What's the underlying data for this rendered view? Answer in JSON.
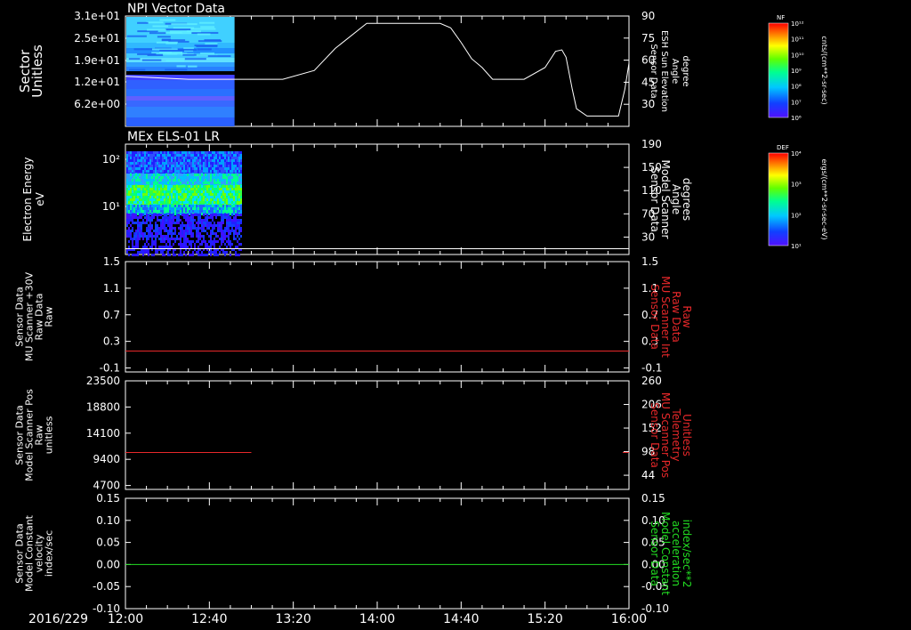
{
  "colors": {
    "background": "#000000",
    "axis": "#ffffff",
    "red_trace": "#e8282a",
    "green_trace": "#22dd22"
  },
  "time_axis": {
    "date_label": "2016/229",
    "tick_labels": [
      "12:00",
      "12:40",
      "13:20",
      "14:00",
      "14:40",
      "15:20",
      "16:00"
    ],
    "range_minutes": [
      0,
      240
    ]
  },
  "chart_data": [
    {
      "type": "heatmap",
      "title": "NPI Vector Data",
      "ylabel": [
        "Sector",
        "Unitless"
      ],
      "y_ticks": [
        "3.1e+01",
        "2.5e+01",
        "1.9e+01",
        "1.2e+01",
        "6.2e+00"
      ],
      "x_extent_minutes": [
        0,
        52
      ],
      "right_axis": {
        "label": [
          "Sensor Data",
          "ESH Sun Elevation",
          "Angle",
          "degree"
        ],
        "ticks": [
          90,
          75,
          60,
          45,
          30
        ],
        "ylim": [
          15,
          90
        ]
      },
      "line": {
        "name": "ESH Sun Elevation Angle",
        "x": [
          0,
          30,
          50,
          75,
          90,
          100,
          115,
          125,
          135,
          145,
          150,
          155,
          160,
          165,
          170,
          175,
          180,
          190,
          200,
          205,
          208,
          210,
          213,
          215,
          220,
          225,
          230,
          235,
          238,
          240
        ],
        "y": [
          49,
          47,
          47,
          47,
          53,
          68,
          85,
          85,
          85,
          85,
          85,
          82,
          72,
          61,
          55,
          47,
          47,
          47,
          55,
          66,
          67,
          62,
          40,
          27,
          22,
          22,
          22,
          22,
          40,
          58
        ]
      },
      "colorbar": {
        "label": "NF",
        "unit": "cnts/(cm**2-sr-sec)",
        "ticks": [
          "10¹²",
          "10¹¹",
          "10¹⁰",
          "10⁹",
          "10⁸",
          "10⁷",
          "10⁶"
        ]
      }
    },
    {
      "type": "heatmap",
      "title": "MEx ELS-01 LR",
      "ylabel": [
        "Electron Energy",
        "eV"
      ],
      "y_ticks": [
        "10²",
        "10¹"
      ],
      "x_extent_minutes": [
        0,
        55
      ],
      "right_axis": {
        "label": [
          "Sensor Data",
          "Model Scanner",
          "Angle",
          "degrees"
        ],
        "ticks": [
          190,
          150,
          110,
          70,
          30
        ],
        "ylim": [
          0,
          190
        ]
      },
      "line": {
        "name": "Model Scanner Angle",
        "x": [
          0,
          240
        ],
        "y": [
          10,
          10
        ]
      },
      "colorbar": {
        "label": "DEF",
        "unit": "ergs/(cm**2-sr-sec-eV)",
        "ticks": [
          "10⁴",
          "10³",
          "10²",
          "10¹"
        ]
      }
    },
    {
      "type": "line",
      "ylabel": [
        "Sensor Data",
        "MU Scanner +30V",
        "Raw Data",
        "Raw"
      ],
      "y_ticks": [
        "1.5",
        "1.1",
        "0.7",
        "0.3",
        "-0.1"
      ],
      "ylim": [
        -0.35,
        1.5
      ],
      "right_axis": {
        "label": [
          "Sensor Data",
          "MU Scanner Int",
          "Raw Data",
          "Raw"
        ],
        "ticks": [
          "1.5",
          "1.1",
          "0.7",
          "0.3",
          "-0.1"
        ],
        "color": "#e8282a"
      },
      "series": [
        {
          "x": [
            0,
            240
          ],
          "y": [
            0.0,
            0.0
          ],
          "color": "#e8282a"
        }
      ]
    },
    {
      "type": "line",
      "ylabel": [
        "Sensor Data",
        "Model Scanner Pos",
        "Raw",
        "unitless"
      ],
      "y_ticks": [
        "23500",
        "18800",
        "14100",
        "9400",
        "4700"
      ],
      "ylim": [
        0,
        23500
      ],
      "right_axis": {
        "label": [
          "Sensor Data",
          "MU Scanner Pos",
          "Telemetry",
          "Unitless"
        ],
        "ticks": [
          "260",
          "206",
          "152",
          "98",
          "44"
        ],
        "ylim": [
          0,
          260
        ],
        "color": "#e8282a"
      },
      "series": [
        {
          "x": [
            0,
            60
          ],
          "y": [
            8000,
            8000
          ],
          "color": "#e8282a"
        },
        {
          "x": [
            237,
            240
          ],
          "y": [
            8000,
            8000
          ],
          "color": "#e8282a"
        }
      ]
    },
    {
      "type": "line",
      "ylabel": [
        "Sensor Data",
        "Model Constant",
        "velocity",
        "index/sec"
      ],
      "y_ticks": [
        "0.15",
        "0.10",
        "0.05",
        "0.00",
        "-0.05",
        "-0.10"
      ],
      "ylim": [
        -0.1,
        0.15
      ],
      "right_axis": {
        "label": [
          "Sensor Data",
          "Model Constant",
          "acceleration",
          "index/sec**2"
        ],
        "ticks": [
          "0.15",
          "0.10",
          "0.05",
          "0.00",
          "-0.05",
          "-0.10"
        ],
        "color": "#22dd22"
      },
      "series": [
        {
          "x": [
            0,
            240
          ],
          "y": [
            0.0,
            0.0
          ],
          "color": "#22dd22"
        }
      ]
    }
  ]
}
